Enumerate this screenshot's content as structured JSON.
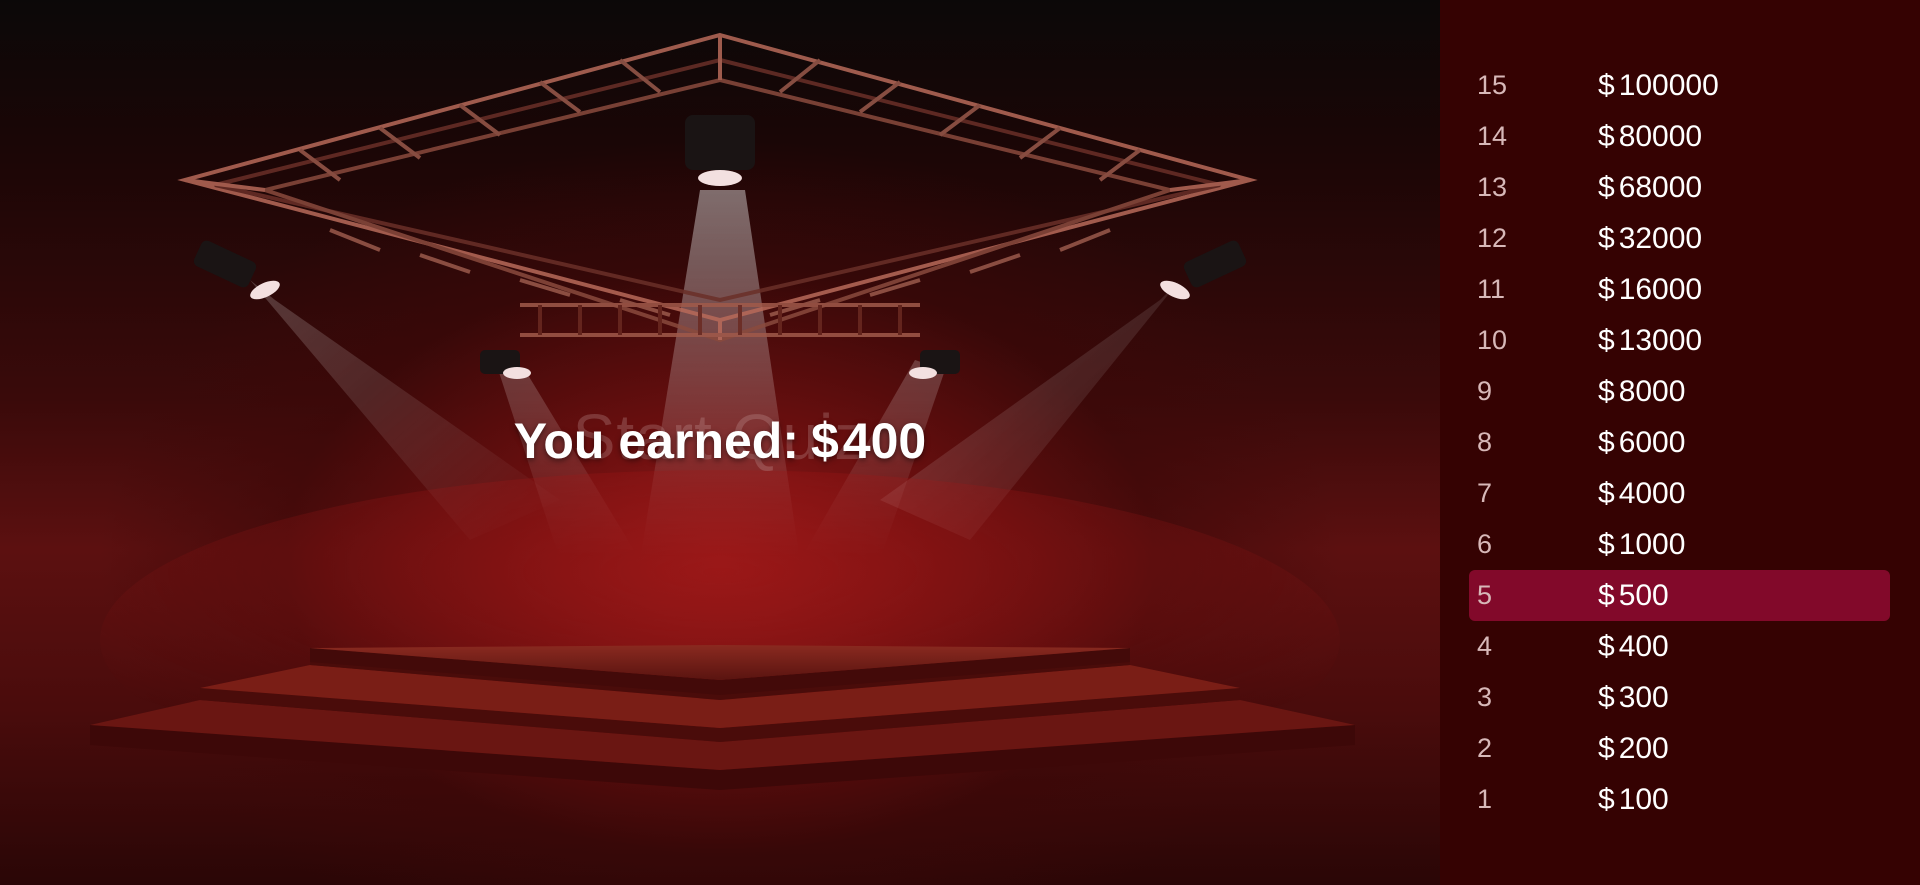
{
  "stage": {
    "background_label": "Start Quiz",
    "earned_label": "You earned:",
    "earned_currency": "$",
    "earned_amount": "400"
  },
  "pyramid": {
    "currency": "$",
    "active_level": 5,
    "levels": [
      {
        "level": "15",
        "amount": "100000"
      },
      {
        "level": "14",
        "amount": "80000"
      },
      {
        "level": "13",
        "amount": "68000"
      },
      {
        "level": "12",
        "amount": "32000"
      },
      {
        "level": "11",
        "amount": "16000"
      },
      {
        "level": "10",
        "amount": "13000"
      },
      {
        "level": "9",
        "amount": "8000"
      },
      {
        "level": "8",
        "amount": "6000"
      },
      {
        "level": "7",
        "amount": "4000"
      },
      {
        "level": "6",
        "amount": "1000"
      },
      {
        "level": "5",
        "amount": "500"
      },
      {
        "level": "4",
        "amount": "400"
      },
      {
        "level": "3",
        "amount": "300"
      },
      {
        "level": "2",
        "amount": "200"
      },
      {
        "level": "1",
        "amount": "100"
      }
    ]
  },
  "colors": {
    "sidebar_bg": "#350202",
    "active_row": "#82092a",
    "text": "#ffffff",
    "level_number": "#d7b8b8"
  }
}
